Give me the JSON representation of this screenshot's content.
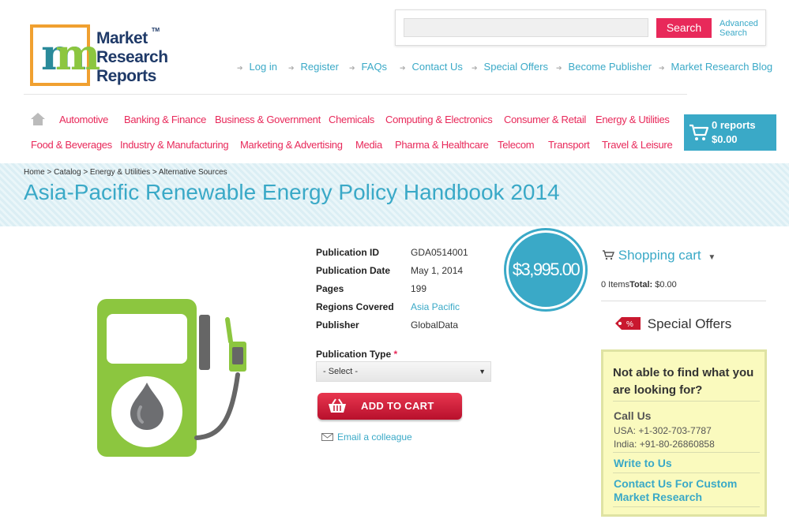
{
  "logo": {
    "text": [
      "Market",
      "Research",
      "Reports"
    ],
    "tm": "TM",
    "letter": "m"
  },
  "search": {
    "button": "Search",
    "advanced": [
      "Advanced",
      "Search"
    ],
    "placeholder": ""
  },
  "topnav": [
    "Log in",
    "Register",
    "FAQs",
    "Contact Us",
    "Special Offers",
    "Become Publisher",
    "Market Research Blog"
  ],
  "categories_row1": [
    "Automotive",
    "Banking & Finance",
    "Business & Government",
    "Chemicals",
    "Computing & Electronics",
    "Consumer & Retail",
    "Energy & Utilities"
  ],
  "categories_row2": [
    "Food & Beverages",
    "Industry & Manufacturing",
    "Marketing & Advertising",
    "Media",
    "Pharma & Healthcare",
    "Telecom",
    "Transport",
    "Travel & Leisure"
  ],
  "cart_header": {
    "reports": "0 reports",
    "total": "$0.00"
  },
  "breadcrumb": "Home > Catalog > Energy & Utilities > Alternative Sources",
  "title": "Asia-Pacific Renewable Energy Policy Handbook 2014",
  "details": [
    {
      "label": "Publication ID",
      "value": "GDA0514001"
    },
    {
      "label": "Publication Date",
      "value": "May 1, 2014"
    },
    {
      "label": "Pages",
      "value": "199"
    },
    {
      "label": "Regions Covered",
      "value": "Asia Pacific"
    },
    {
      "label": "Publisher",
      "value": "GlobalData"
    }
  ],
  "price": "$3,995.00",
  "publication_type": {
    "label": "Publication Type",
    "required": "*",
    "selected": "- Select -"
  },
  "add_to_cart": "ADD TO CART",
  "email_colleague": "Email a colleague",
  "shopping_cart": {
    "title": "Shopping cart",
    "items": "0 Items",
    "total_label": "Total:",
    "total_value": "$0.00"
  },
  "special_offers": {
    "title": "Special Offers",
    "tag": "%"
  },
  "help": {
    "question": "Not able to find what you are looking for?",
    "call_us": "Call Us",
    "usa": "USA: +1-302-703-7787",
    "india": "India: +91-80-26860858",
    "write_us": "Write to Us",
    "custom": "Contact Us For Custom Market Research"
  },
  "colors": {
    "accent": "#3aa9c7",
    "pink": "#e8295a",
    "green": "#8cc63f"
  }
}
